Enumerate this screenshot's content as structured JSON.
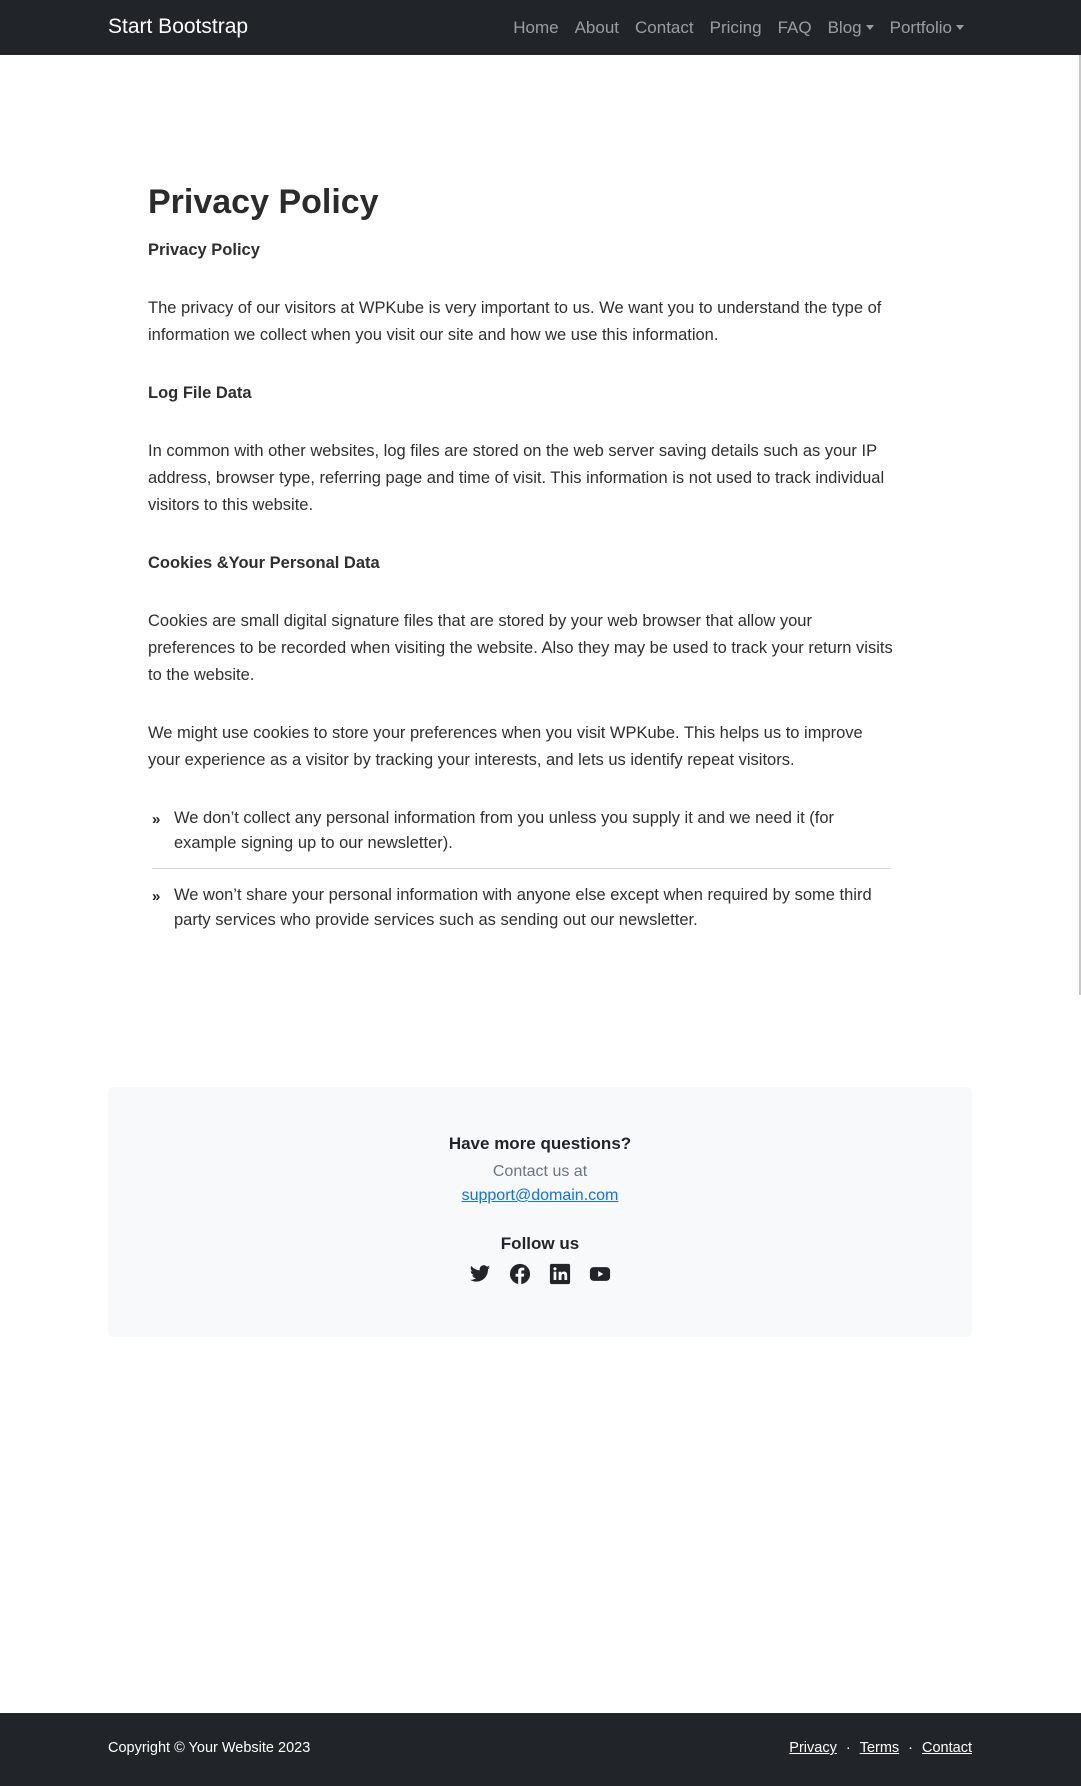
{
  "navbar": {
    "brand": "Start Bootstrap",
    "links": [
      {
        "label": "Home"
      },
      {
        "label": "About"
      },
      {
        "label": "Contact"
      },
      {
        "label": "Pricing"
      },
      {
        "label": "FAQ"
      },
      {
        "label": "Blog",
        "dropdown": true
      },
      {
        "label": "Portfolio",
        "dropdown": true
      }
    ]
  },
  "main": {
    "title": "Privacy Policy",
    "subheading_1": "Privacy Policy",
    "paragraph_1": "The privacy of our visitors at WPKube is very important to us. We want you to understand the type of information we collect when you visit our site and how we use this information.",
    "subheading_2": "Log File Data",
    "paragraph_2": "In common with other websites, log files are stored on the web server saving details such as your IP address, browser type, referring page and time of visit. This information is not used to track individual visitors to this website.",
    "subheading_3": "Cookies &Your Personal Data",
    "paragraph_3": "Cookies are small digital signature files that are stored by your web browser that allow your preferences to be recorded when visiting the website. Also they may be used to track your return visits to the website.",
    "paragraph_4": "We might use cookies to store your preferences when you visit WPKube. This helps us to improve your experience as a visitor by tracking your interests, and lets us identify repeat visitors.",
    "list": [
      "We don’t collect any personal information from you unless you supply it and we need it (for example signing up to our newsletter).",
      "We won’t share your personal information with anyone else except when required by some third party services who provide services such as sending out our newsletter."
    ]
  },
  "cta": {
    "title": "Have more questions?",
    "text": "Contact us at",
    "email": "support@domain.com",
    "follow": "Follow us",
    "socials": [
      "twitter-icon",
      "facebook-icon",
      "linkedin-icon",
      "youtube-icon"
    ]
  },
  "footer": {
    "copyright": "Copyright © Your Website 2023",
    "links": [
      "Privacy",
      "Terms",
      "Contact"
    ],
    "separator": "·"
  },
  "colors": {
    "navbar_bg": "#212529",
    "link": "#0d6efd",
    "cta_bg": "#f8f9fa"
  }
}
